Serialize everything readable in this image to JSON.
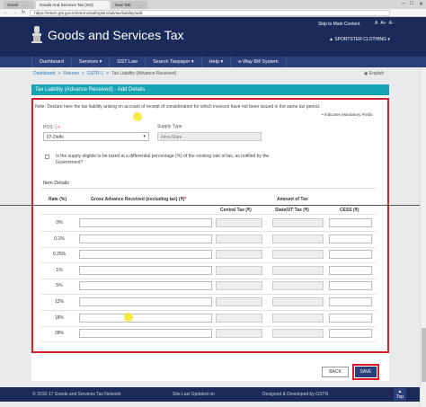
{
  "browser": {
    "tabs": [
      "Gmail",
      "Goods And Services Tax (GS)",
      "New Tab"
    ],
    "address": "https://return.gst.gov.in/returns/auth/gstr1/advtax/liability/add"
  },
  "header": {
    "title": "Goods and Services Tax",
    "skip_link": "Skip to Main Content",
    "accessibility": [
      "A",
      "A+",
      "A-"
    ],
    "user": "▲ SPORTSTER CLOTHING ▾"
  },
  "nav": [
    "Dashboard",
    "Services ▾",
    "GST Law",
    "Search Taxpayer ▾",
    "Help ▾",
    "e-Way Bill System"
  ],
  "breadcrumb": [
    "Dashboard",
    ">",
    "Returns",
    ">",
    "GSTR-1",
    ">",
    "Tax Liability (Advance Received)"
  ],
  "language": "English",
  "panel_title": "Tax Liability (Advance Received) - Add Details",
  "note": "Note: Declare here the tax liability arising on account of receipt of consideration for which invoices have not been issued in the same tax period.",
  "mandatory": "Indicates Mandatory Fields",
  "form": {
    "pos_label": "POS",
    "pos_value": "07-Delhi",
    "supply_label": "Supply Type",
    "supply_value": "Intra-State",
    "checkbox_text": "Is the supply eligible to be taxed at a differential percentage (%) of the existing rate of tax, as notified by the Government?",
    "item_details": "Item Details"
  },
  "table": {
    "col_rate": "Rate (%)",
    "col_gross": "Gross Advance Received (excluding tax) (₹)",
    "col_amount": "Amount of Tax",
    "col_central": "Central Tax (₹)",
    "col_state": "State/UT Tax (₹)",
    "col_cess": "CESS (₹)",
    "rates": [
      "0%",
      "0.1%",
      "0.25%",
      "1%",
      "5%",
      "12%",
      "18%",
      "28%"
    ]
  },
  "buttons": {
    "back": "BACK",
    "save": "SAVE",
    "top": "Top"
  },
  "footer": {
    "copyright": "© 2016-17 Goods and Services Tax Network",
    "updated": "Site Last Updated on",
    "designed": "Designed & Developed by GSTN"
  }
}
